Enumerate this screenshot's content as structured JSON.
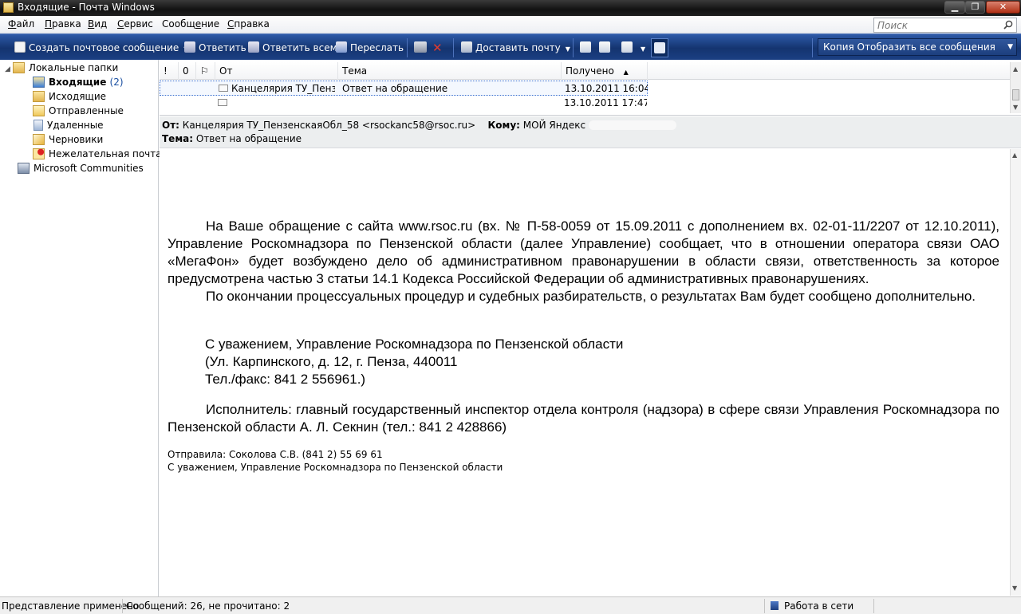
{
  "window": {
    "title": "Входящие - Почта Windows",
    "controls": {
      "minimize": "▁",
      "maximize": "❐",
      "close": "✕"
    }
  },
  "menu": {
    "items": [
      {
        "u": "Ф",
        "rest": "айл"
      },
      {
        "u": "П",
        "rest": "равка"
      },
      {
        "u": "В",
        "rest": "ид"
      },
      {
        "u": "С",
        "rest": "ервис"
      },
      {
        "pre": "Сообщ",
        "u": "е",
        "rest": "ние"
      },
      {
        "u": "С",
        "rest": "правка"
      }
    ]
  },
  "search": {
    "placeholder": "Поиск"
  },
  "toolbar": {
    "create": "Создать почтовое сообщение",
    "reply": "Ответить",
    "reply_all": "Ответить всем",
    "forward": "Переслать",
    "deliver": "Доставить почту",
    "view": "Копия Отобразить все сообщения"
  },
  "folders": {
    "root": "Локальные папки",
    "inbox": "Входящие",
    "inbox_count": "(2)",
    "outbox": "Исходящие",
    "sent": "Отправленные",
    "deleted": "Удаленные",
    "drafts": "Черновики",
    "junk": "Нежелательная почта",
    "communities": "Microsoft Communities"
  },
  "columns": {
    "priority": "!",
    "attachment": "0",
    "flag": "⚐",
    "from": "От",
    "subject": "Тема",
    "received": "Получено"
  },
  "messages": [
    {
      "from": "Канцелярия ТУ_Пенз...",
      "subject": "Ответ на обращение",
      "received": "13.10.2011 16:04"
    },
    {
      "from": "",
      "subject": "",
      "received": "13.10.2011 17:47"
    }
  ],
  "preview": {
    "from_label": "От:",
    "from_value": "Канцелярия ТУ_ПензенскаяОбл_58 <rsockanc58@rsoc.ru>",
    "to_label": "Кому:",
    "to_value": "МОЙ Яндекс",
    "subject_label": "Тема:",
    "subject_value": "Ответ на обращение"
  },
  "body": {
    "p1_a": "На Ваше обращение с сайта",
    "p1_link": "www.rsoc.ru",
    "p1_b": "(вх. № П-58-0059 от 15.09.2011 с дополнением вх. 02-01-11/2207 от 12.10.2011), Управление Роскомнадзора по Пензенской области (далее Управление) сообщает, что в отношении оператора связи ОАО «МегаФон» будет возбуждено дело об административном правонарушении в области связи, ответственность за которое предусмотрена частью 3 статьи 14.1 Кодекса Российской Федерации об административных правонарушениях.",
    "p2": "По окончании процессуальных процедур и судебных разбирательств, о результатах Вам будет сообщено дополнительно.",
    "sig1": "С уважением, Управление Роскомнадзора по Пензенской области",
    "sig2": "(Ул. Карпинского, д. 12, г. Пенза, 440011",
    "sig3": "Тел./факс: 841 2 556961.)",
    "p3": "Исполнитель: главный государственный инспектор отдела контроля (надзора) в сфере связи Управления Роскомнадзора по Пензенской области А. Л. Секнин (тел.: 841 2 428866)",
    "small1": "Отправила: Соколова С.В.  (841 2) 55 69 61",
    "small2": "С уважением, Управление Роскомнадзора по Пензенской области"
  },
  "status": {
    "view_applied": "Представление применено",
    "counts": "Сообщений: 26, не прочитано: 2",
    "online": "Работа в сети"
  },
  "colors": {
    "toolbar": "#1b3f83",
    "selection_border": "#3b6fcf",
    "count": "#1a4fa1"
  }
}
